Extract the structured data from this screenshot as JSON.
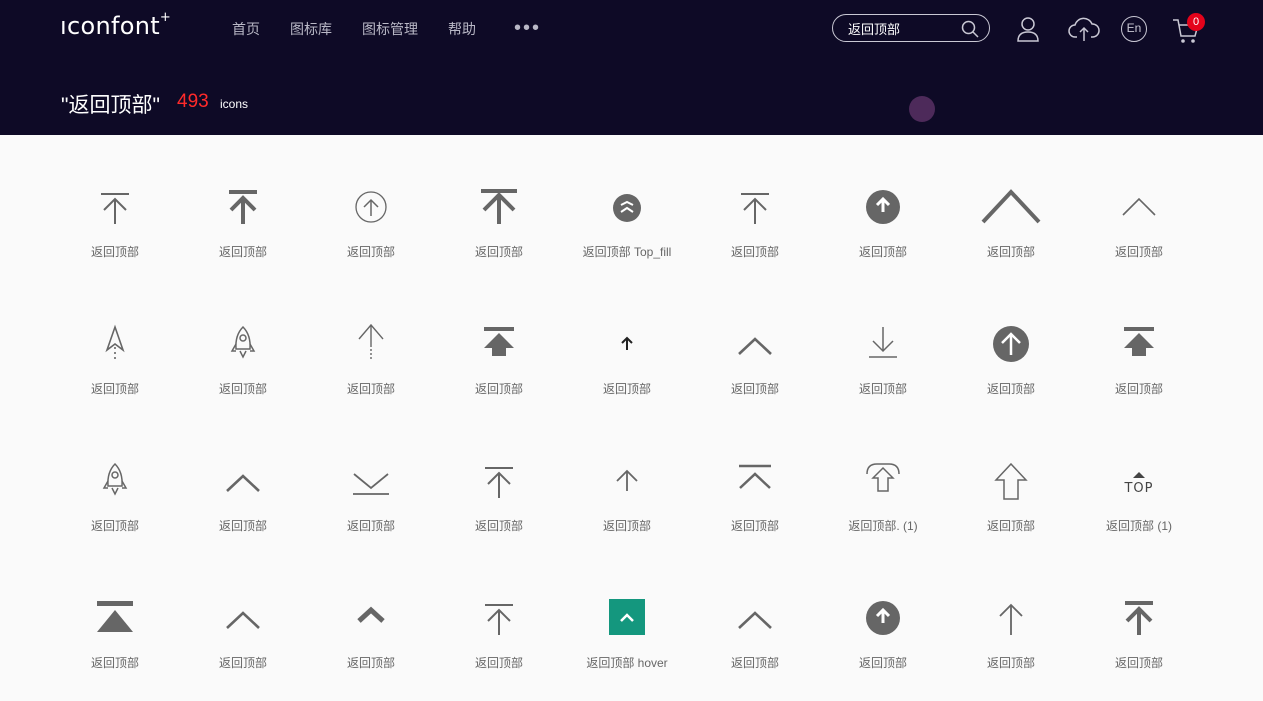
{
  "header": {
    "logo": "ıconfont",
    "logo_mark": "+",
    "nav": [
      "首页",
      "图标库",
      "图标管理",
      "帮助"
    ],
    "nav_more": "•••",
    "search": {
      "value": "返回顶部"
    },
    "cart_count": "0",
    "lang_label": "En"
  },
  "results": {
    "title": "\"返回顶部\"",
    "count": "493",
    "unit": "icons"
  },
  "colors": {
    "header_bg": "#0e0a26",
    "count": "#ff2a2a",
    "icon": "#666666",
    "teal_tile": "#14977e"
  },
  "icons": [
    {
      "label": "返回顶部",
      "icon": "arrow-up-bar-thin-icon"
    },
    {
      "label": "返回顶部",
      "icon": "arrow-up-bar-bold-icon"
    },
    {
      "label": "返回顶部",
      "icon": "arrow-up-circle-outline-icon"
    },
    {
      "label": "返回顶部",
      "icon": "arrow-up-bar-large-icon"
    },
    {
      "label": "返回顶部 Top_fill",
      "icon": "top-fill-circle-icon"
    },
    {
      "label": "返回顶部",
      "icon": "arrow-up-bar-thin-icon"
    },
    {
      "label": "返回顶部",
      "icon": "arrow-up-circle-filled-icon"
    },
    {
      "label": "返回顶部",
      "icon": "chevron-up-large-icon"
    },
    {
      "label": "返回顶部",
      "icon": "chevron-up-thin-icon"
    },
    {
      "label": "返回顶部",
      "icon": "paper-plane-up-icon"
    },
    {
      "label": "返回顶部",
      "icon": "rocket-outline-icon"
    },
    {
      "label": "返回顶部",
      "icon": "arrow-up-dotted-icon"
    },
    {
      "label": "返回顶部",
      "icon": "arrow-up-bar-filled-icon"
    },
    {
      "label": "返回顶部",
      "icon": "arrow-up-small-icon"
    },
    {
      "label": "返回顶部",
      "icon": "chevron-up-medium-icon"
    },
    {
      "label": "返回顶部",
      "icon": "arrow-down-bar-icon"
    },
    {
      "label": "返回顶部",
      "icon": "arrow-up-circle-filled-large-icon"
    },
    {
      "label": "返回顶部",
      "icon": "arrow-up-bar-filled-icon"
    },
    {
      "label": "返回顶部",
      "icon": "rocket-outline-icon"
    },
    {
      "label": "返回顶部",
      "icon": "chevron-up-medium-icon"
    },
    {
      "label": "返回顶部",
      "icon": "chevron-down-bar-icon"
    },
    {
      "label": "返回顶部",
      "icon": "arrow-up-bar-thin-icon"
    },
    {
      "label": "返回顶部",
      "icon": "arrow-up-small-thin-icon"
    },
    {
      "label": "返回顶部",
      "icon": "chevron-up-bar-icon"
    },
    {
      "label": "返回顶部. (1)",
      "icon": "arrow-up-box-icon"
    },
    {
      "label": "返回顶部",
      "icon": "arrow-up-outline-icon"
    },
    {
      "label": "返回顶部 (1)",
      "icon": "top-text-icon"
    },
    {
      "label": "返回顶部",
      "icon": "triangle-up-bar-icon"
    },
    {
      "label": "返回顶部",
      "icon": "chevron-up-medium-icon"
    },
    {
      "label": "返回顶部",
      "icon": "chevron-up-bold-icon"
    },
    {
      "label": "返回顶部",
      "icon": "arrow-up-bar-thin-icon"
    },
    {
      "label": "返回顶部 hover",
      "icon": "chevron-up-teal-tile-icon"
    },
    {
      "label": "返回顶部",
      "icon": "chevron-up-medium-icon"
    },
    {
      "label": "返回顶部",
      "icon": "arrow-up-circle-filled-icon"
    },
    {
      "label": "返回顶部",
      "icon": "arrow-up-thin-icon"
    },
    {
      "label": "返回顶部",
      "icon": "arrow-up-bar-bold-icon"
    }
  ]
}
